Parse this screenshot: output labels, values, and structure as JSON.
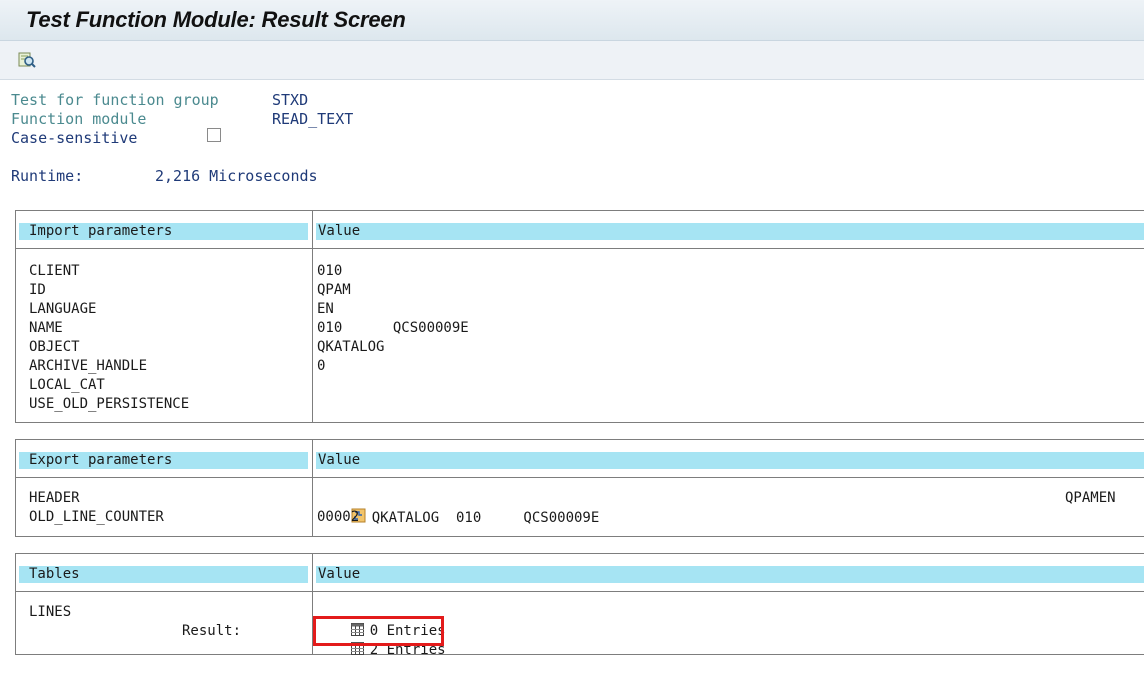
{
  "window": {
    "title": "Test Function Module: Result Screen"
  },
  "toolbar": {
    "icons": [
      "magnifier-icon"
    ]
  },
  "info": {
    "group_label": "Test for function group",
    "group_value": "STXD",
    "module_label": "Function module",
    "module_value": "READ_TEXT",
    "case_label": "Case-sensitive",
    "runtime_label": "Runtime:",
    "runtime_value": "2,216 Microseconds"
  },
  "import": {
    "header_left": "Import parameters",
    "header_right": "Value",
    "rows": [
      {
        "name": "CLIENT",
        "value": "010"
      },
      {
        "name": "ID",
        "value": "QPAM"
      },
      {
        "name": "LANGUAGE",
        "value": "EN"
      },
      {
        "name": "NAME",
        "value": "010      QCS00009E"
      },
      {
        "name": "OBJECT",
        "value": "QKATALOG"
      },
      {
        "name": "ARCHIVE_HANDLE",
        "value": "0"
      },
      {
        "name": "LOCAL_CAT",
        "value": ""
      },
      {
        "name": "USE_OLD_PERSISTENCE",
        "value": ""
      }
    ]
  },
  "export": {
    "header_left": "Export parameters",
    "header_right": "Value",
    "rows": [
      {
        "name": "HEADER",
        "value": "QKATALOG  010     QCS00009E",
        "value_right": "QPAMEN"
      },
      {
        "name": "OLD_LINE_COUNTER",
        "value": "00002"
      }
    ]
  },
  "tables": {
    "header_left": "Tables",
    "header_right": "Value",
    "lines_label": "LINES",
    "result_label": "Result:",
    "lines_value": "0 Entries",
    "result_value": "2 Entries"
  },
  "colors": {
    "header_fill": "#a6e4f3",
    "label_teal": "#4b8a8f",
    "value_navy": "#1f3a78",
    "highlight": "#e31b1b"
  }
}
